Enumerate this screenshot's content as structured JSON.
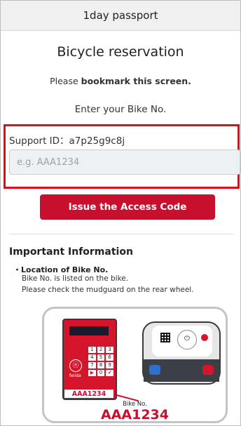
{
  "header": {
    "title": "1day passport"
  },
  "main": {
    "title": "Bicycle reservation",
    "bookmark": {
      "prefix": "Please ",
      "bold": "bookmark this screen."
    },
    "enter_label": "Enter your Bike No.",
    "support_id": "Support ID：a7p25g9c8j",
    "bike_no_input": {
      "placeholder": "e.g. AAA1234",
      "value": ""
    },
    "issue_button": "Issue the Access Code"
  },
  "info": {
    "heading": "Important Information",
    "location_title": "・Location of Bike No.",
    "line1": "Bike No. is listed on the bike.",
    "line2": "Please check the mudguard on the rear wheel."
  },
  "illustration": {
    "device_brand": "feiida",
    "keys": [
      "1",
      "2",
      "3",
      "4",
      "5",
      "6",
      "7",
      "8",
      "9",
      "▶",
      "0",
      "✔"
    ],
    "label_on_device": "AAA1234",
    "bike_no_caption": "Bike No.",
    "bike_no_value": "AAA1234"
  },
  "colors": {
    "accent_red": "#c8102e",
    "outline_red": "#e30b17",
    "input_bg": "#eef1f4",
    "header_bg": "#f0f0f0"
  }
}
